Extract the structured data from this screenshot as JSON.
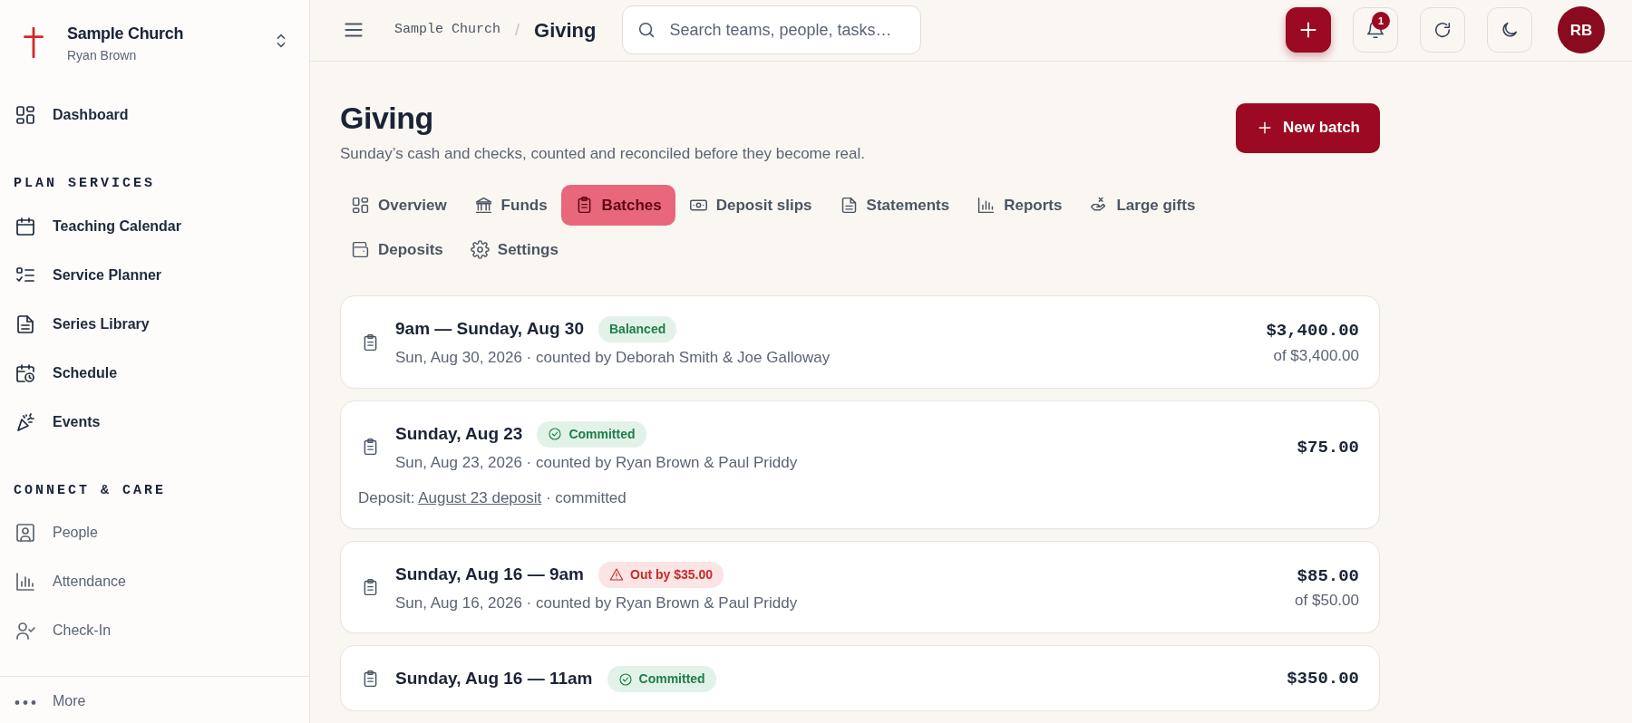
{
  "sidebar": {
    "org": "Sample Church",
    "user": "Ryan Brown",
    "top_items": [
      "Dashboard"
    ],
    "sections": [
      {
        "title": "PLAN SERVICES",
        "items": [
          "Teaching Calendar",
          "Service Planner",
          "Series Library",
          "Schedule",
          "Events"
        ]
      },
      {
        "title": "CONNECT & CARE",
        "items": [
          "People",
          "Attendance",
          "Check-In"
        ]
      }
    ],
    "more": "More"
  },
  "topbar": {
    "breadcrumb": [
      "Sample Church",
      "Giving"
    ],
    "separator": "/",
    "search": {
      "placeholder": "Search teams, people, tasks…"
    },
    "notifications": "1",
    "avatar": "RB"
  },
  "page": {
    "title": "Giving",
    "subtitle": "Sunday’s cash and checks, counted and reconciled before they become real.",
    "action": "New batch"
  },
  "tabs": [
    {
      "label": "Overview",
      "selected": false
    },
    {
      "label": "Funds",
      "selected": false
    },
    {
      "label": "Batches",
      "selected": true
    },
    {
      "label": "Deposit slips",
      "selected": false
    },
    {
      "label": "Statements",
      "selected": false
    },
    {
      "label": "Reports",
      "selected": false
    },
    {
      "label": "Large gifts",
      "selected": false
    },
    {
      "label": "Deposits",
      "selected": false
    },
    {
      "label": "Settings",
      "selected": false
    }
  ],
  "batches": [
    {
      "title": "9am — Sunday, Aug 30",
      "status": {
        "kind": "balanced",
        "label": "Balanced"
      },
      "meta": "Sun, Aug 30, 2026 · counted by Deborah Smith & Joe Galloway",
      "amount": "$3,400.00",
      "expected": "of $3,400.00"
    },
    {
      "title": "Sunday, Aug 23",
      "status": {
        "kind": "committed",
        "label": "Committed"
      },
      "meta": "Sun, Aug 23, 2026 · counted by Ryan Brown & Paul Priddy",
      "amount": "$75.00",
      "deposit": {
        "prefix": "Deposit:",
        "link": "August 23 deposit",
        "suffix": "· committed"
      }
    },
    {
      "title": "Sunday, Aug 16 — 9am",
      "status": {
        "kind": "out",
        "label": "Out by $35.00"
      },
      "meta": "Sun, Aug 16, 2026 · counted by Ryan Brown & Paul Priddy",
      "amount": "$85.00",
      "expected": "of $50.00"
    },
    {
      "title": "Sunday, Aug 16 — 11am",
      "status": {
        "kind": "committed",
        "label": "Committed"
      },
      "amount": "$350.00"
    }
  ]
}
